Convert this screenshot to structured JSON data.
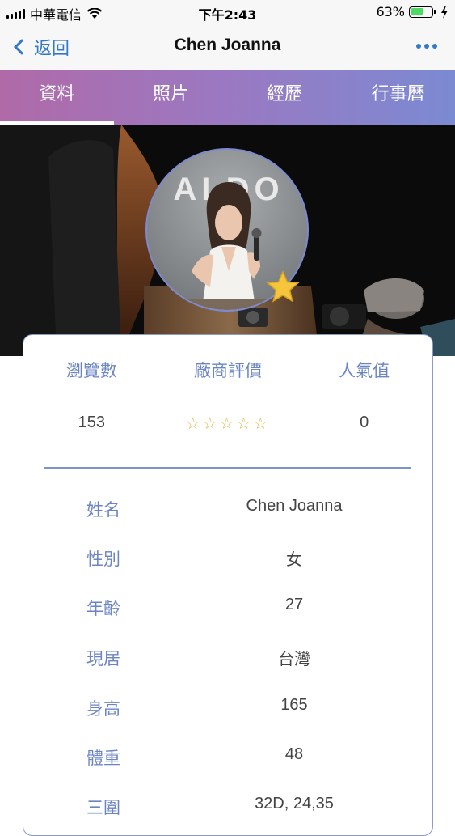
{
  "status": {
    "carrier": "中華電信",
    "time": "下午2:43",
    "battery": "63%",
    "battery_level": 0.63
  },
  "nav": {
    "back_label": "返回",
    "title": "Chen Joanna"
  },
  "tabs": [
    {
      "label": "資料",
      "active": true
    },
    {
      "label": "照片",
      "active": false
    },
    {
      "label": "經歷",
      "active": false
    },
    {
      "label": "行事曆",
      "active": false
    }
  ],
  "banner": {
    "sign_text": "ALDO"
  },
  "stats": {
    "headers": [
      "瀏覽數",
      "廠商評價",
      "人氣值"
    ],
    "views": "153",
    "rating_stars": "☆☆☆☆☆",
    "popularity": "0"
  },
  "info": [
    {
      "label": "姓名",
      "value": "Chen Joanna"
    },
    {
      "label": "性別",
      "value": "女"
    },
    {
      "label": "年齡",
      "value": "27"
    },
    {
      "label": "現居",
      "value": "台灣"
    },
    {
      "label": "身高",
      "value": "165"
    },
    {
      "label": "體重",
      "value": "48"
    },
    {
      "label": "三圍",
      "value": "32D, 24,35"
    }
  ],
  "colors": {
    "accent": "#3478c8",
    "label": "#6b84c4",
    "tab_gradient_start": "#b06aa8",
    "tab_gradient_end": "#7b8ad2",
    "star": "#e6b84a"
  },
  "icons": [
    "wifi-icon",
    "charging-bolt-icon",
    "back-chevron-icon",
    "more-dots-icon",
    "star-badge-icon"
  ]
}
